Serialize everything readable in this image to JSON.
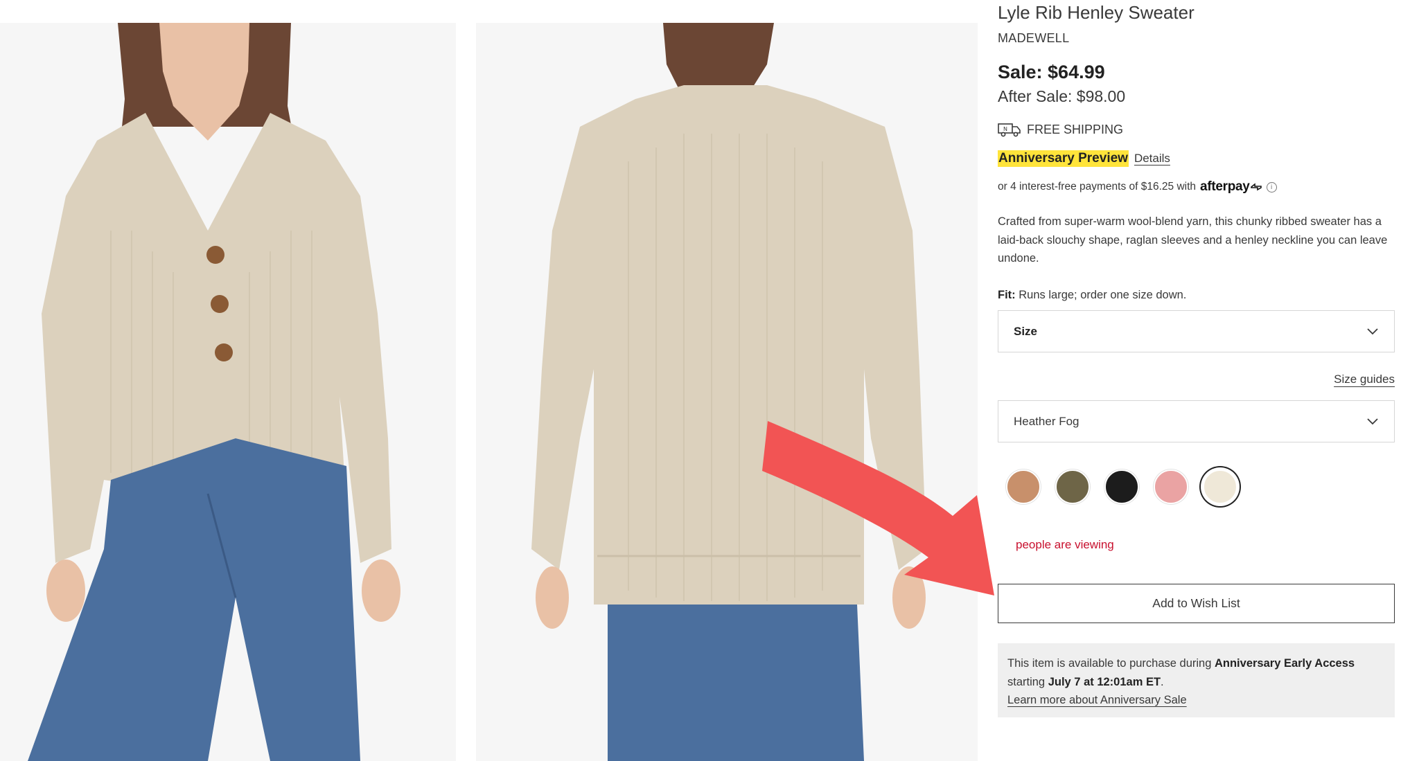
{
  "product": {
    "title": "Lyle Rib Henley Sweater",
    "brand": "MADEWELL",
    "sale_price": "Sale: $64.99",
    "after_sale_price": "After Sale: $98.00",
    "shipping_label": "FREE SHIPPING",
    "anniversary_badge": "Anniversary Preview",
    "details_link": "Details",
    "afterpay_text": "or 4 interest-free payments of $16.25 with",
    "afterpay_brand": "afterpay",
    "description": "Crafted from super-warm wool-blend yarn, this chunky ribbed sweater has a laid-back slouchy shape, raglan sleeves and a henley neckline you can leave undone.",
    "fit_label": "Fit:",
    "fit_value": "Runs large; order one size down."
  },
  "size_select": {
    "label": "Size"
  },
  "size_guides_link": "Size guides",
  "color_select": {
    "selected": "Heather Fog"
  },
  "swatches": [
    {
      "name": "camel",
      "color": "#c8906b"
    },
    {
      "name": "olive",
      "color": "#6e6547"
    },
    {
      "name": "black",
      "color": "#1c1c1c"
    },
    {
      "name": "pink",
      "color": "#eaa3a3"
    },
    {
      "name": "heather-fog",
      "color": "#efe8d8"
    }
  ],
  "viewing": {
    "count": "",
    "text": "people are viewing"
  },
  "wishlist_button": "Add to Wish List",
  "early_access": {
    "line1_prefix": "This item is available to purchase during ",
    "line1_bold": "Anniversary Early Access",
    "line2_prefix": "starting ",
    "line2_bold": "July 7 at 12:01am ET",
    "line2_suffix": ".",
    "learn_more": "Learn more about Anniversary Sale"
  },
  "colors": {
    "badge_yellow": "#ffe43b",
    "alert_red": "#c8102e",
    "arrow_red": "#f25454",
    "text": "#393939",
    "sweater": "#dcd1bd",
    "denim": "#4b6f9e"
  }
}
